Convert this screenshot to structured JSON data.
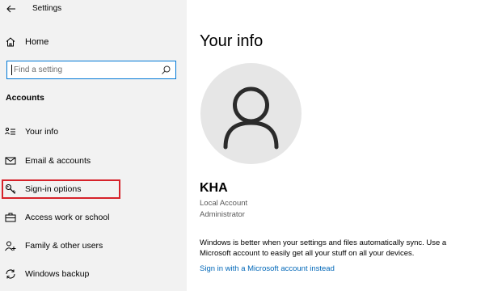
{
  "window": {
    "title": "Settings"
  },
  "sidebar": {
    "home_label": "Home",
    "search": {
      "placeholder": "Find a setting"
    },
    "section_label": "Accounts",
    "items": [
      {
        "label": "Your info",
        "icon": "person-list-icon"
      },
      {
        "label": "Email & accounts",
        "icon": "mail-icon"
      },
      {
        "label": "Sign-in options",
        "icon": "key-icon",
        "selected": true
      },
      {
        "label": "Access work or school",
        "icon": "briefcase-icon"
      },
      {
        "label": "Family & other users",
        "icon": "add-person-icon"
      },
      {
        "label": "Windows backup",
        "icon": "sync-icon"
      }
    ]
  },
  "main": {
    "title": "Your info",
    "user": {
      "name": "KHA",
      "account_type": "Local Account",
      "role": "Administrator"
    },
    "sync_text": "Windows is better when your settings and files automatically sync. Use a Microsoft account to easily get all your stuff on all your devices.",
    "link_label": "Sign in with a Microsoft account instead"
  },
  "colors": {
    "sidebar_bg": "#f2f2f2",
    "accent": "#0078d7",
    "link": "#0067b8",
    "highlight": "#d6222a",
    "avatar_bg": "#e6e6e6"
  }
}
